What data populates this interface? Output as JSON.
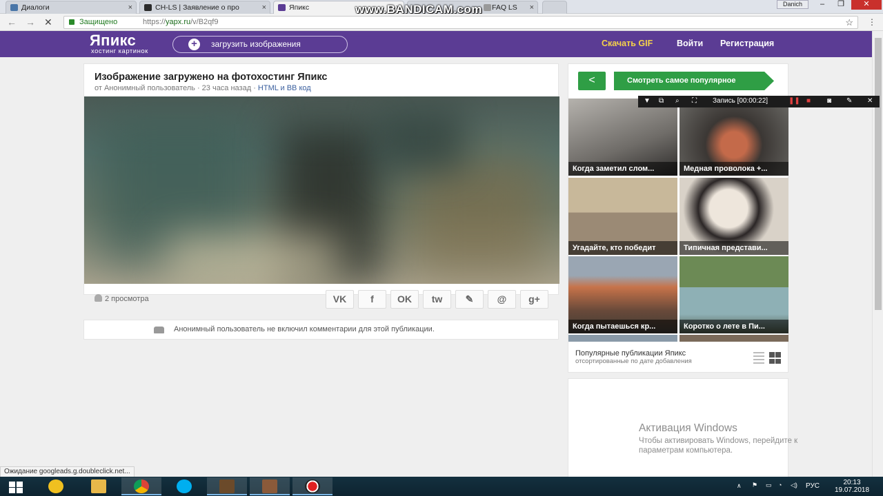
{
  "browser": {
    "tabs": [
      {
        "title": "Диалоги",
        "color": "#4a76a8"
      },
      {
        "title": "CH-LS | Заявление о про",
        "color": "#2b2b2b"
      },
      {
        "title": "Япикс",
        "color": "#5b3c94"
      },
      {
        "title": "FAQ LS",
        "color": "#999999"
      }
    ],
    "user": "Danich",
    "watermark": "www.BANDICAM.com",
    "secure_label": "Защищено",
    "url_prefix": "https://",
    "url_host": "yapx.ru",
    "url_path": "/v/B2qf9"
  },
  "header": {
    "logo_title": "Япикс",
    "logo_sub": "хостинг картинок",
    "upload_label": "загрузить изображения",
    "nav": {
      "gif": "Скачать GIF",
      "login": "Войти",
      "register": "Регистрация"
    }
  },
  "post": {
    "title": "Изображение загружено на фотохостинг Япикс",
    "meta_author": "от Анонимный пользователь · 23 часа назад ·",
    "meta_link": "HTML и BB код",
    "views": "2 просмотра",
    "share_buttons": [
      "VK",
      "f",
      "OK",
      "tw",
      "✎",
      "@",
      "g+"
    ],
    "comments_note": "Анонимный пользователь не включил комментарии для этой публикации."
  },
  "sidebar": {
    "back_label": "<",
    "popular_label": "Смотреть самое популярное",
    "thumbs": [
      {
        "caption": "Когда заметил слом...",
        "bg": "#8a8885"
      },
      {
        "caption": "Медная проволока +...",
        "bg": "#6a4a3a"
      },
      {
        "caption": "Угадайте, кто победит",
        "bg": "#b8a88a"
      },
      {
        "caption": "Типичная представи...",
        "bg": "#d6cfc5"
      },
      {
        "caption": "Когда пытаешься кр...",
        "bg": "#8c5b3f"
      },
      {
        "caption": "Коротко о лете в Пи...",
        "bg": "#5c7a4a"
      }
    ],
    "popular_title": "Популярные публикации Япикс",
    "popular_sub": "отсортированные по дате добавления"
  },
  "recorder": {
    "label": "Запись [00:00:22]"
  },
  "activation": {
    "title": "Активация Windows",
    "line1": "Чтобы активировать Windows, перейдите к",
    "line2": "параметрам компьютера."
  },
  "status_text": "Ожидание googleads.g.doubleclick.net...",
  "taskbar": {
    "lang": "РУС",
    "time": "20:13",
    "date": "19.07.2018"
  }
}
